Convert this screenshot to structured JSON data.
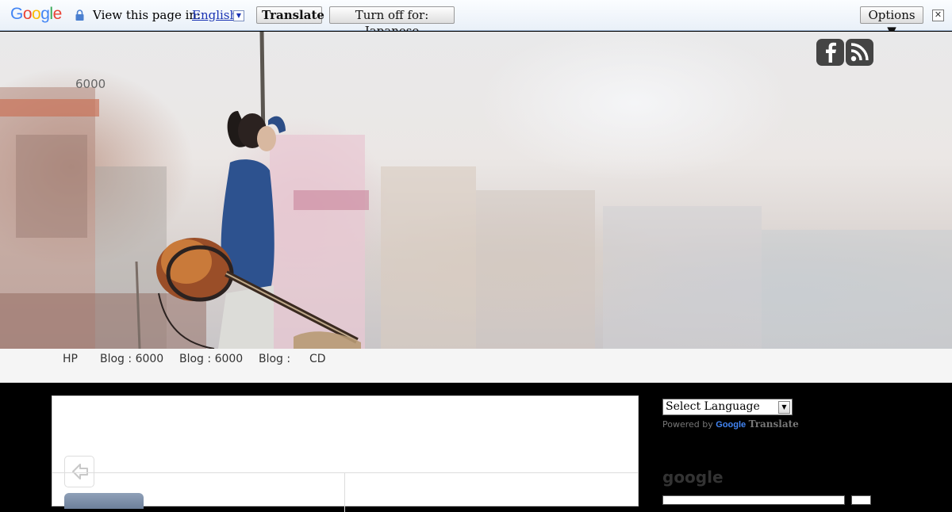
{
  "translate_bar": {
    "logo_letters": [
      {
        "ch": "G",
        "color": "#4285f4"
      },
      {
        "ch": "o",
        "color": "#ea4335"
      },
      {
        "ch": "o",
        "color": "#fbbc05"
      },
      {
        "ch": "g",
        "color": "#4285f4"
      },
      {
        "ch": "l",
        "color": "#34a853"
      },
      {
        "ch": "e",
        "color": "#ea4335"
      }
    ],
    "view_label": "View this page in:",
    "language": "English",
    "translate_button": "Translate",
    "turn_off_button": "Turn off for: Japanese",
    "options_button": "Options ▼",
    "close_glyph": "✕",
    "lock_icon": "lock-icon"
  },
  "header": {
    "site_name": "6000",
    "social": [
      "facebook-icon",
      "rss-icon"
    ]
  },
  "nav": {
    "items": [
      "HP",
      "Blog : 6000",
      "Blog : 6000",
      "Blog :",
      "CD"
    ]
  },
  "sidebar": {
    "language_select": "Select Language",
    "powered_by": "Powered by",
    "google_word": "Google",
    "translate_word": "Translate",
    "heading": "google"
  },
  "colors": {
    "accent_link": "#1a33b3",
    "page_bg": "#000000"
  }
}
